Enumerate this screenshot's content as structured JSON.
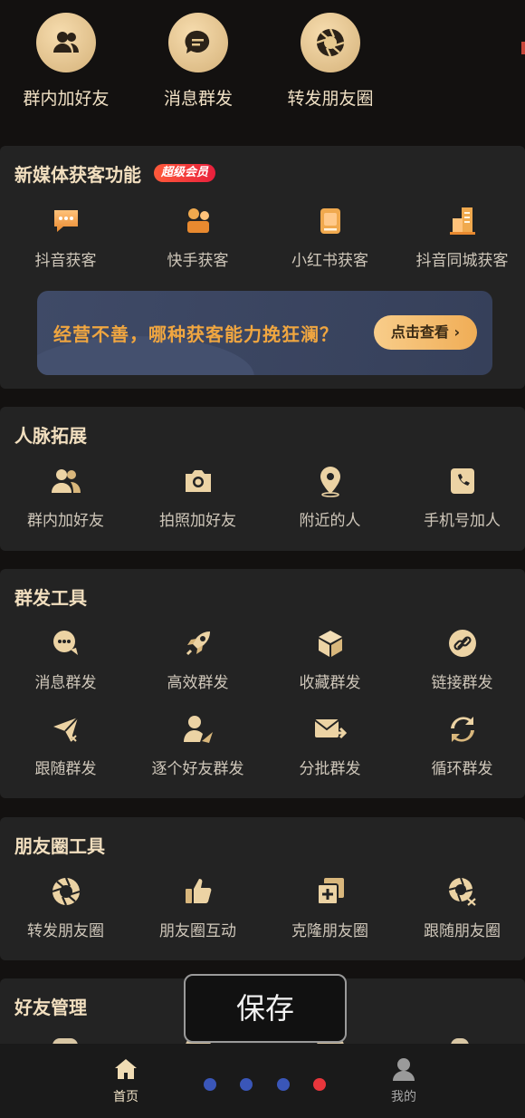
{
  "top_row": {
    "items": [
      {
        "label": "群内加好友",
        "icon": "group-friends-icon"
      },
      {
        "label": "消息群发",
        "icon": "message-icon"
      },
      {
        "label": "转发朋友圈",
        "icon": "aperture-icon"
      }
    ]
  },
  "new_media": {
    "title": "新媒体获客功能",
    "badge": "超级会员",
    "items": [
      {
        "label": "抖音获客",
        "icon": "chat-bubble-icon"
      },
      {
        "label": "快手获客",
        "icon": "camera-user-icon"
      },
      {
        "label": "小红书获客",
        "icon": "book-icon"
      },
      {
        "label": "抖音同城获客",
        "icon": "buildings-icon"
      }
    ],
    "banner_text": "经营不善，哪种获客能力挽狂澜？",
    "banner_button": "点击查看"
  },
  "network": {
    "title": "人脉拓展",
    "items": [
      {
        "label": "群内加好友",
        "icon": "group-friends-icon"
      },
      {
        "label": "拍照加好友",
        "icon": "camera-icon"
      },
      {
        "label": "附近的人",
        "icon": "location-pin-icon"
      },
      {
        "label": "手机号加人",
        "icon": "phone-icon"
      }
    ]
  },
  "broadcast": {
    "title": "群发工具",
    "items": [
      {
        "label": "消息群发",
        "icon": "chat-dots-icon"
      },
      {
        "label": "高效群发",
        "icon": "rocket-icon"
      },
      {
        "label": "收藏群发",
        "icon": "box-icon"
      },
      {
        "label": "链接群发",
        "icon": "link-icon"
      },
      {
        "label": "跟随群发",
        "icon": "paper-plane-icon"
      },
      {
        "label": "逐个好友群发",
        "icon": "user-send-icon"
      },
      {
        "label": "分批群发",
        "icon": "mail-forward-icon"
      },
      {
        "label": "循环群发",
        "icon": "cycle-icon"
      }
    ]
  },
  "moments": {
    "title": "朋友圈工具",
    "items": [
      {
        "label": "转发朋友圈",
        "icon": "aperture-icon"
      },
      {
        "label": "朋友圈互动",
        "icon": "thumbs-up-icon"
      },
      {
        "label": "克隆朋友圈",
        "icon": "clone-icon"
      },
      {
        "label": "跟随朋友圈",
        "icon": "aperture-shuffle-icon"
      }
    ]
  },
  "friend_mgmt": {
    "title": "好友管理"
  },
  "toast": {
    "text": "保存"
  },
  "tabbar": {
    "home_label": "首页",
    "mine_label": "我的"
  },
  "colors": {
    "accent": "#e8c98e",
    "background": "#131110",
    "card": "#232323",
    "dot_blue": "#3a56b8",
    "dot_red": "#e8363c"
  }
}
